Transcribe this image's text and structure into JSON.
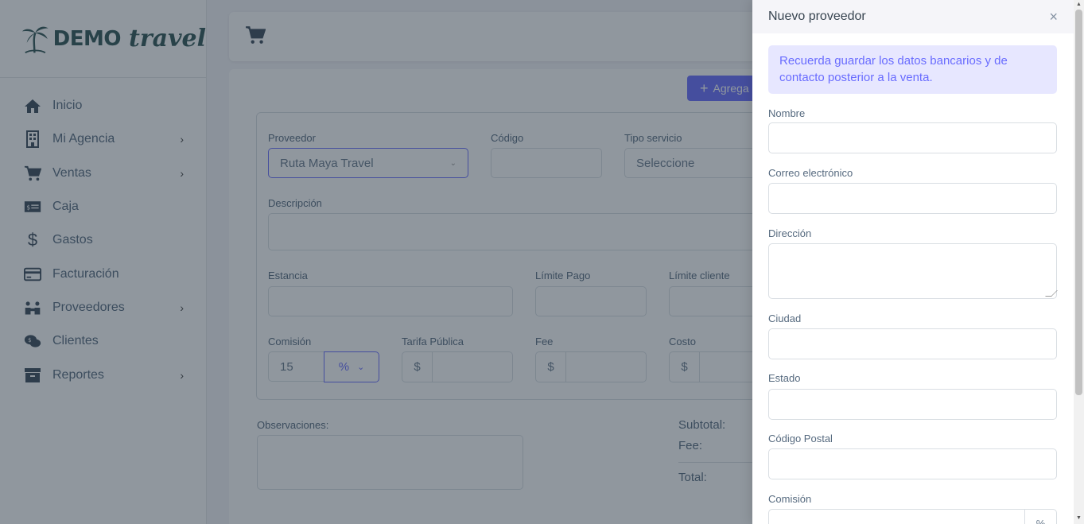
{
  "sidebar": {
    "logo_demo": "DEMO",
    "logo_travel": "travel",
    "items": [
      {
        "label": "Inicio",
        "icon": "home-icon",
        "chevron": false
      },
      {
        "label": "Mi Agencia",
        "icon": "building-icon",
        "chevron": true
      },
      {
        "label": "Ventas",
        "icon": "cart-icon",
        "chevron": true
      },
      {
        "label": "Caja",
        "icon": "cash-icon",
        "chevron": false
      },
      {
        "label": "Gastos",
        "icon": "dollar-icon",
        "chevron": false
      },
      {
        "label": "Facturación",
        "icon": "credit-card-icon",
        "chevron": false
      },
      {
        "label": "Proveedores",
        "icon": "people-icon",
        "chevron": true
      },
      {
        "label": "Clientes",
        "icon": "chat-icon",
        "chevron": false
      },
      {
        "label": "Reportes",
        "icon": "archive-icon",
        "chevron": true
      }
    ]
  },
  "main": {
    "add_button": "Agrega",
    "form": {
      "proveedor_label": "Proveedor",
      "proveedor_value": "Ruta Maya Travel",
      "codigo_label": "Código",
      "tipo_label": "Tipo servicio",
      "tipo_value": "Seleccione",
      "descripcion_label": "Descripción",
      "estancia_label": "Estancia",
      "limite_pago_label": "Límite Pago",
      "limite_cliente_label": "Límite cliente",
      "comision_label": "Comisión",
      "comision_value": "15",
      "comision_unit": "%",
      "tarifa_label": "Tarifa Pública",
      "fee_label": "Fee",
      "costo_label": "Costo",
      "currency": "$"
    },
    "observaciones_label": "Observaciones:",
    "subtotal_label": "Subtotal:",
    "fee_total_label": "Fee:",
    "total_label": "Total:"
  },
  "panel": {
    "title": "Nuevo proveedor",
    "close": "×",
    "alert": "Recuerda guardar los datos bancarios y de contacto posterior a la venta.",
    "fields": {
      "nombre": "Nombre",
      "correo": "Correo electrónico",
      "direccion": "Dirección",
      "ciudad": "Ciudad",
      "estado": "Estado",
      "codigo_postal": "Código Postal",
      "comision": "Comisión",
      "comision_unit": "%"
    }
  }
}
